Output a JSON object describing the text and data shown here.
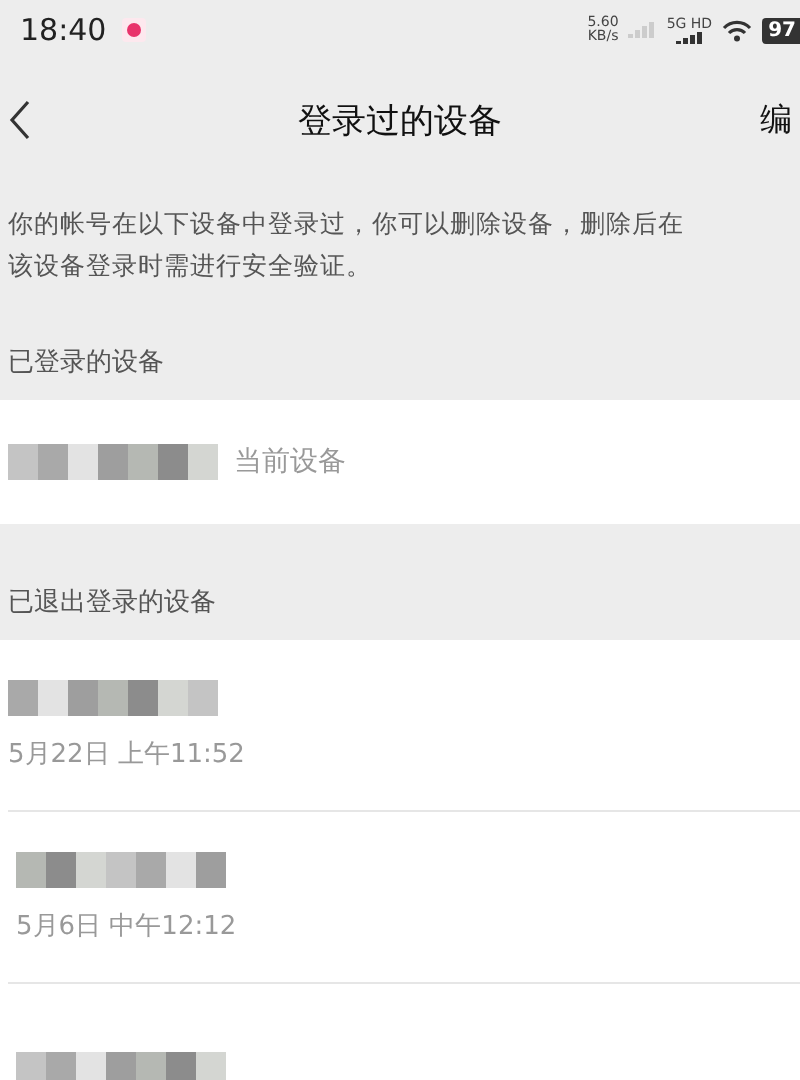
{
  "status_bar": {
    "time": "18:40",
    "speed_value": "5.60",
    "speed_unit": "KB/s",
    "network": "5G HD",
    "battery": "97"
  },
  "nav": {
    "title": "登录过的设备",
    "action": "编"
  },
  "description_lines": [
    "你的帐号在以下设备中登录过，你可以删除设备，删除后在",
    "该设备登录时需进行安全验证。"
  ],
  "sections": [
    {
      "title": "已登录的设备",
      "devices": [
        {
          "name_blurred": true,
          "tag": "当前设备"
        }
      ]
    },
    {
      "title": "已退出登录的设备",
      "devices": [
        {
          "name_blurred": true,
          "time": "5月22日 上午11:52"
        },
        {
          "name_blurred": true,
          "time": "5月6日 中午12:12"
        },
        {
          "name_blurred": true
        }
      ]
    }
  ]
}
